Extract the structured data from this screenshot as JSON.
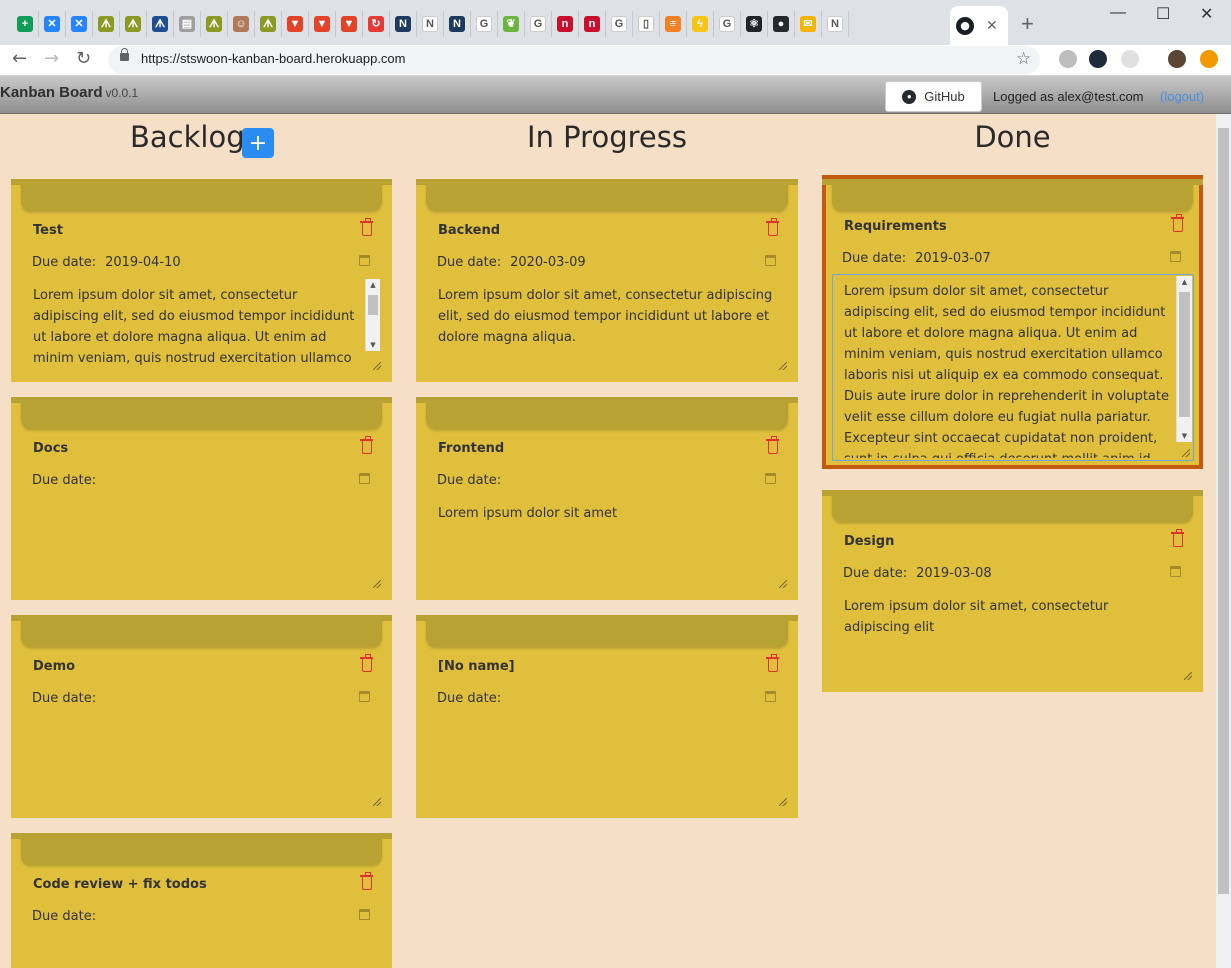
{
  "browser": {
    "tabs": [
      {
        "icon": "sheets-icon",
        "color": "#0f9d58",
        "glyph": "+"
      },
      {
        "icon": "confluence-icon",
        "color": "#2684ff",
        "glyph": "✕"
      },
      {
        "icon": "confluence-icon",
        "color": "#2684ff",
        "glyph": "✕"
      },
      {
        "icon": "jenkins-icon",
        "color": "#8a9a24",
        "glyph": "ᗑ"
      },
      {
        "icon": "jenkins-icon",
        "color": "#8a9a24",
        "glyph": "ᗑ"
      },
      {
        "icon": "jira-icon",
        "color": "#1d4f91",
        "glyph": "ᗑ"
      },
      {
        "icon": "document-icon",
        "color": "#9e9e9e",
        "glyph": "▤"
      },
      {
        "icon": "jenkins-icon",
        "color": "#8a9a24",
        "glyph": "ᗑ"
      },
      {
        "icon": "jenkins-butler-icon",
        "color": "#b07a5a",
        "glyph": "☺"
      },
      {
        "icon": "jenkins-icon",
        "color": "#8a9a24",
        "glyph": "ᗑ"
      },
      {
        "icon": "gitlab-icon",
        "color": "#e24329",
        "glyph": "▼"
      },
      {
        "icon": "gitlab-icon",
        "color": "#e24329",
        "glyph": "▼"
      },
      {
        "icon": "gitlab-icon",
        "color": "#e24329",
        "glyph": "▼"
      },
      {
        "icon": "sync-icon",
        "color": "#e53935",
        "glyph": "↻"
      },
      {
        "icon": "nw-icon",
        "color": "#1f3a5f",
        "glyph": "N"
      },
      {
        "icon": "notion-icon",
        "color": "#ffffff",
        "glyph": "N"
      },
      {
        "icon": "nw-icon",
        "color": "#1f3a5f",
        "glyph": "N"
      },
      {
        "icon": "google-icon",
        "color": "#ffffff",
        "glyph": "G"
      },
      {
        "icon": "spring-icon",
        "color": "#6db33f",
        "glyph": "❦"
      },
      {
        "icon": "google-icon",
        "color": "#ffffff",
        "glyph": "G"
      },
      {
        "icon": "n-red-icon",
        "color": "#c8102e",
        "glyph": "n"
      },
      {
        "icon": "n-red-icon",
        "color": "#c8102e",
        "glyph": "n"
      },
      {
        "icon": "google-icon",
        "color": "#ffffff",
        "glyph": "G"
      },
      {
        "icon": "blank-page-icon",
        "color": "#ffffff",
        "glyph": "▯"
      },
      {
        "icon": "stackoverflow-icon",
        "color": "#f48024",
        "glyph": "≡"
      },
      {
        "icon": "lightning-icon",
        "color": "#f5c518",
        "glyph": "ϟ"
      },
      {
        "icon": "google-icon",
        "color": "#ffffff",
        "glyph": "G"
      },
      {
        "icon": "react-icon",
        "color": "#20232a",
        "glyph": "⚛"
      },
      {
        "icon": "github-icon",
        "color": "#24292e",
        "glyph": "●"
      },
      {
        "icon": "mail-icon",
        "color": "#f4b400",
        "glyph": "✉"
      },
      {
        "icon": "notion-icon",
        "color": "#ffffff",
        "glyph": "N"
      }
    ],
    "url": "https://stswoon-kanban-board.herokuapp.com"
  },
  "app": {
    "title": "Kanban Board",
    "version": "v0.0.1",
    "github_label": "GitHub",
    "logged_as": "Logged as alex@test.com",
    "logout_label": "(logout)"
  },
  "board": {
    "due_label": "Due date:",
    "columns": [
      {
        "title": "Backlog",
        "add_label": "+"
      },
      {
        "title": "In Progress"
      },
      {
        "title": "Done"
      }
    ],
    "cards": {
      "test": {
        "title": "Test",
        "due": "2019-04-10",
        "desc": "Lorem ipsum dolor sit amet, consectetur adipiscing elit, sed do eiusmod tempor incididunt ut labore et dolore magna aliqua. Ut enim ad minim veniam, quis nostrud exercitation ullamco laboris nisi ut"
      },
      "docs": {
        "title": "Docs",
        "due": "",
        "desc": ""
      },
      "demo": {
        "title": "Demo",
        "due": "",
        "desc": ""
      },
      "codereview": {
        "title": "Code review + fix todos",
        "due": "",
        "desc": ""
      },
      "backend": {
        "title": "Backend",
        "due": "2020-03-09",
        "desc": "Lorem ipsum dolor sit amet, consectetur adipiscing elit, sed do eiusmod tempor incididunt ut labore et dolore magna aliqua."
      },
      "frontend": {
        "title": "Frontend",
        "due": "",
        "desc": "Lorem ipsum dolor sit amet"
      },
      "noname": {
        "title": "[No name]",
        "due": "",
        "desc": ""
      },
      "requirements": {
        "title": "Requirements",
        "due": "2019-03-07",
        "desc": "Lorem ipsum dolor sit amet, consectetur adipiscing elit, sed do eiusmod tempor incididunt ut labore et dolore magna aliqua. Ut enim ad minim veniam, quis nostrud exercitation ullamco laboris nisi ut aliquip ex ea commodo consequat. Duis aute irure dolor in reprehenderit in voluptate velit esse cillum dolore eu fugiat nulla pariatur. Excepteur sint occaecat cupidatat non proident, sunt in culpa qui officia deserunt mollit anim id est laborum."
      },
      "design": {
        "title": "Design",
        "due": "2019-03-08",
        "desc": "Lorem ipsum dolor sit amet, consectetur adipiscing elit"
      }
    }
  },
  "colors": {
    "board_bg": "#f6dfc7",
    "card_bg": "#dfbf3c",
    "card_tab": "#b8a233",
    "selected_border": "#c25a10",
    "add_button": "#2a8cf0",
    "trash": "#e0312c"
  }
}
